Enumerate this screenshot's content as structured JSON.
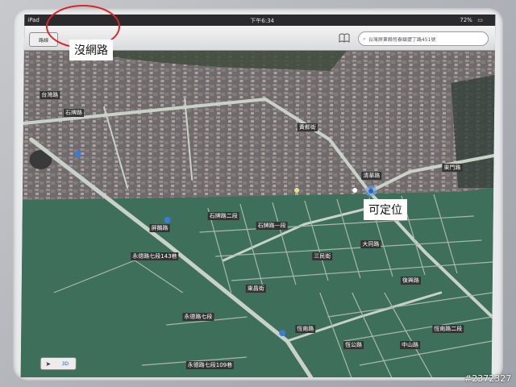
{
  "status_bar": {
    "device": "iPad",
    "time": "下午6:34",
    "battery": "72%"
  },
  "toolbar": {
    "directions_label": "路線",
    "bookmarks_icon": "book-icon",
    "search_value": "台灣屏東縣恆春鎮墾丁路451號"
  },
  "map": {
    "street_labels": [
      "台灣路",
      "石牌路",
      "黃都街",
      "清華路",
      "石牌路一段",
      "石牌路二段",
      "屏鵝路",
      "永德路七段143巷",
      "永德路七段",
      "永德路七段109巷",
      "東昌街",
      "三民街",
      "大同路",
      "復興路",
      "恆南路",
      "恆公路",
      "中山路",
      "恆南路二段",
      "東門路"
    ]
  },
  "controls": {
    "locate_icon": "location-arrow-icon",
    "mode_3d": "3D"
  },
  "annotations": {
    "no_network": "沒網路",
    "can_locate": "可定位"
  },
  "watermark": "#2372327",
  "colors": {
    "accent_blue": "#2a62c9",
    "annotation_red": "#d8262b",
    "map_green": "#3d6b5a"
  }
}
